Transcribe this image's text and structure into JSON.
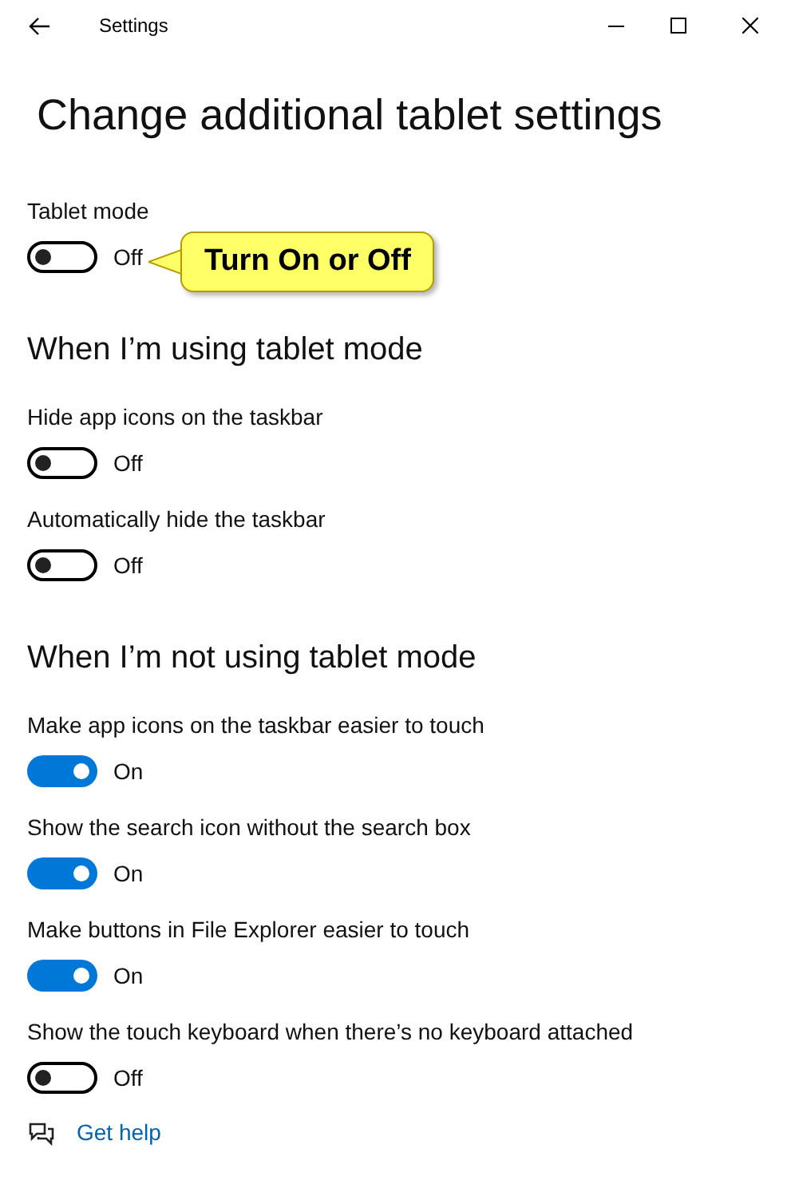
{
  "window": {
    "title": "Settings"
  },
  "heading": "Change additional tablet settings",
  "tablet_mode": {
    "label": "Tablet mode",
    "on": false,
    "state_text": "Off"
  },
  "callout": {
    "text": "Turn On or Off"
  },
  "sections": [
    {
      "title": "When I’m using tablet mode",
      "settings": [
        {
          "label": "Hide app icons on the taskbar",
          "on": false,
          "state_text": "Off"
        },
        {
          "label": "Automatically hide the taskbar",
          "on": false,
          "state_text": "Off"
        }
      ]
    },
    {
      "title": "When I’m not using tablet mode",
      "settings": [
        {
          "label": "Make app icons on the taskbar easier to touch",
          "on": true,
          "state_text": "On"
        },
        {
          "label": "Show the search icon without the search box",
          "on": true,
          "state_text": "On"
        },
        {
          "label": "Make buttons in File Explorer easier to touch",
          "on": true,
          "state_text": "On"
        },
        {
          "label": "Show the touch keyboard when there’s no keyboard attached",
          "on": false,
          "state_text": "Off"
        }
      ]
    }
  ],
  "help_link": "Get help"
}
